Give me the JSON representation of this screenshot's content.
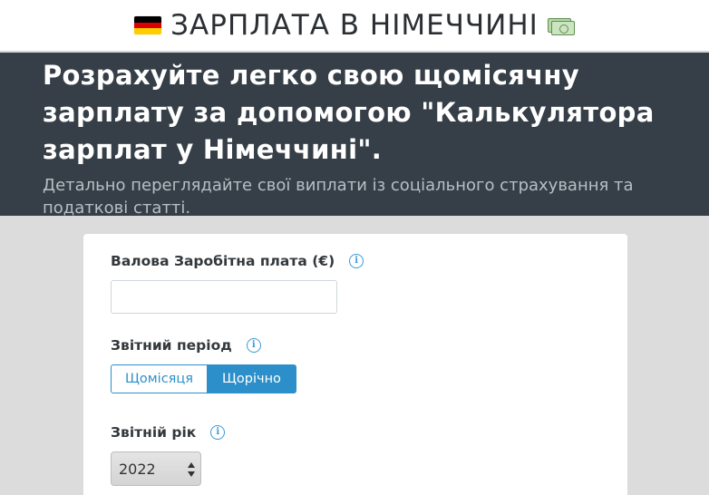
{
  "header": {
    "title": "ЗАРПЛАТА В НІМЕЧЧИНІ",
    "flag_icon": "germany-flag-icon",
    "money_icon": "money-bill-icon",
    "flag_colors": [
      "#000000",
      "#dd0000",
      "#ffce00"
    ]
  },
  "hero": {
    "headline": "Розрахуйте легко свою щомісячну зарплату за допомогою \"Калькулятора зарплат у Німеччині\".",
    "subline": "Детально переглядайте свої виплати із соціального страхування та податкові статті."
  },
  "form": {
    "gross_salary": {
      "label": "Валова Заробітна плата (€)",
      "value": "",
      "placeholder": ""
    },
    "period": {
      "label": "Звітний період",
      "options": [
        "Щомісяця",
        "Щорічно"
      ],
      "selected": "Щорічно"
    },
    "year": {
      "label": "Звітній рік",
      "selected": "2022"
    },
    "info_icon": "info-icon"
  },
  "colors": {
    "accent": "#2d8fc9",
    "hero_bg": "#363f47",
    "page_bg": "#dcdcdc"
  }
}
